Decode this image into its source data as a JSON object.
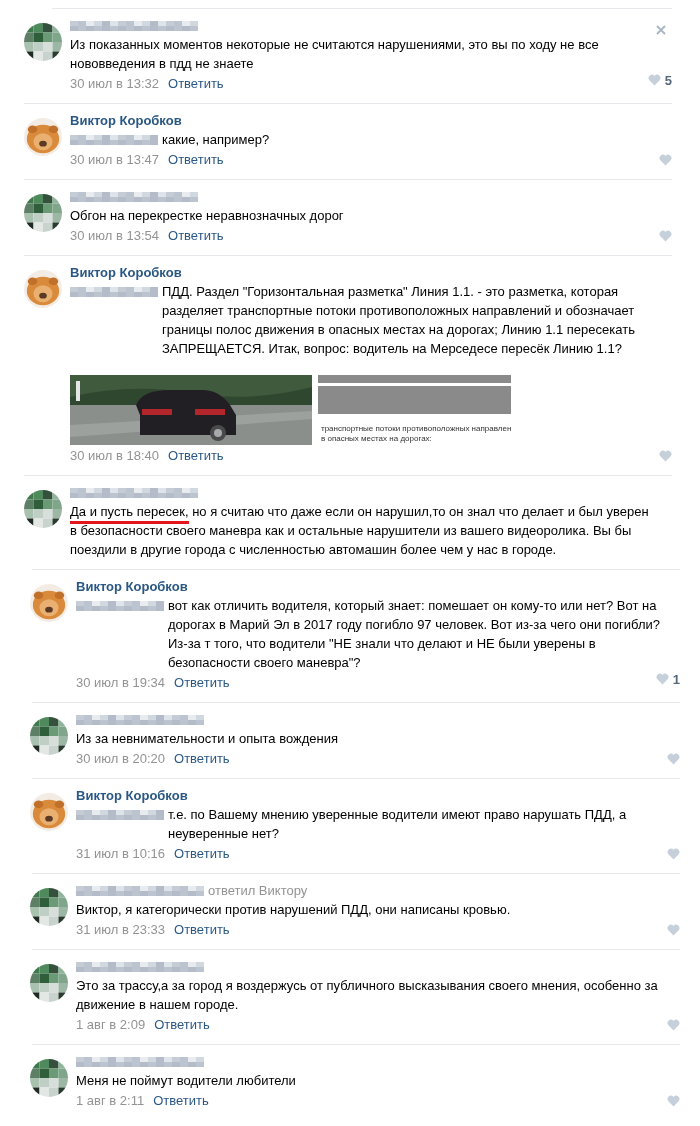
{
  "comments": [
    {
      "nested": false,
      "hidden_mention": false,
      "text": "Из показанных моментов некоторые не считаются нарушениями, это вы по ходу не все нововведения в пдд не знаете",
      "date": "30 июл в 13:32",
      "reply_label": "Ответить",
      "likes": "5",
      "closable": true
    },
    {
      "author": "Виктор Коробков",
      "nested": false,
      "hidden_mention": true,
      "text": "какие, например?",
      "date": "30 июл в 13:47",
      "reply_label": "Ответить"
    },
    {
      "nested": false,
      "hidden_mention": false,
      "text": "Обгон на перекрестке неравнозначных дорог",
      "date": "30 июл в 13:54",
      "reply_label": "Ответить"
    },
    {
      "author": "Виктор Коробков",
      "nested": false,
      "hidden_mention": true,
      "text": "ПДД. Раздел \"Горизонтальная разметка\" Линия 1.1. - это разметка, которая разделяет транспортные потоки противоположных направлений и обозначает границы полос движения в опасных местах на дорогах; Линию 1.1 пересекать ЗАПРЕЩАЕТСЯ. Итак, вопрос: водитель на Мерседесе пересёк Линию 1.1?",
      "attachments": [
        {
          "kind": "picture"
        },
        {
          "kind": "document",
          "lines": [
            "транспортные потоки противоположных направлен",
            "в опасных местах на дорогах:"
          ]
        }
      ],
      "date": "30 июл в 18:40",
      "reply_label": "Ответить"
    },
    {
      "nested": false,
      "hidden_mention": false,
      "marked": "Да и пусть пересек,",
      "text": " но я считаю что даже если он нарушил,то он знал что делает и был уверен в безопасности своего маневра как и остальные нарушители из вашего видеоролика. Вы бы поездили в другие города с численностью автомашин более чем у нас в городе."
    },
    {
      "author": "Виктор Коробков",
      "nested": true,
      "hidden_mention": true,
      "text": "вот как отличить водителя, который знает: помешает он кому-то или нет? Вот на дорогах в Марий Эл в 2017 году погибло 97 человек. Вот из-за чего они погибли? Из-за т того, что водители \"НЕ знали что делают и НЕ были уверены в безопасности своего маневра\"?",
      "date": "30 июл в 19:34",
      "reply_label": "Ответить",
      "likes": "1"
    },
    {
      "nested": true,
      "hidden_mention": false,
      "text": "Из за невнимательности и опыта вождения",
      "date": "30 июл в 20:20",
      "reply_label": "Ответить"
    },
    {
      "author": "Виктор Коробков",
      "nested": true,
      "hidden_mention": true,
      "text": "т.е. по Вашему мнению уверенные водители имеют право нарушать ПДД, а неуверенные нет?",
      "date": "31 июл в 10:16",
      "reply_label": "Ответить"
    },
    {
      "nested": true,
      "hidden_mention": false,
      "reply_to": "ответил Виктору",
      "text": "Виктор, я категорически против нарушений ПДД, они написаны кровью.",
      "date": "31 июл в 23:33",
      "reply_label": "Ответить"
    },
    {
      "nested": true,
      "hidden_mention": false,
      "text": "Это за трассу,а за город я воздержусь от публичного высказывания своего мнения, особенно за движение в нашем городе.",
      "date": "1 авг в 2:09",
      "reply_label": "Ответить"
    },
    {
      "nested": true,
      "hidden_mention": false,
      "text": "Меня не поймут водители любители",
      "date": "1 авг в 2:11",
      "reply_label": "Ответить"
    }
  ]
}
